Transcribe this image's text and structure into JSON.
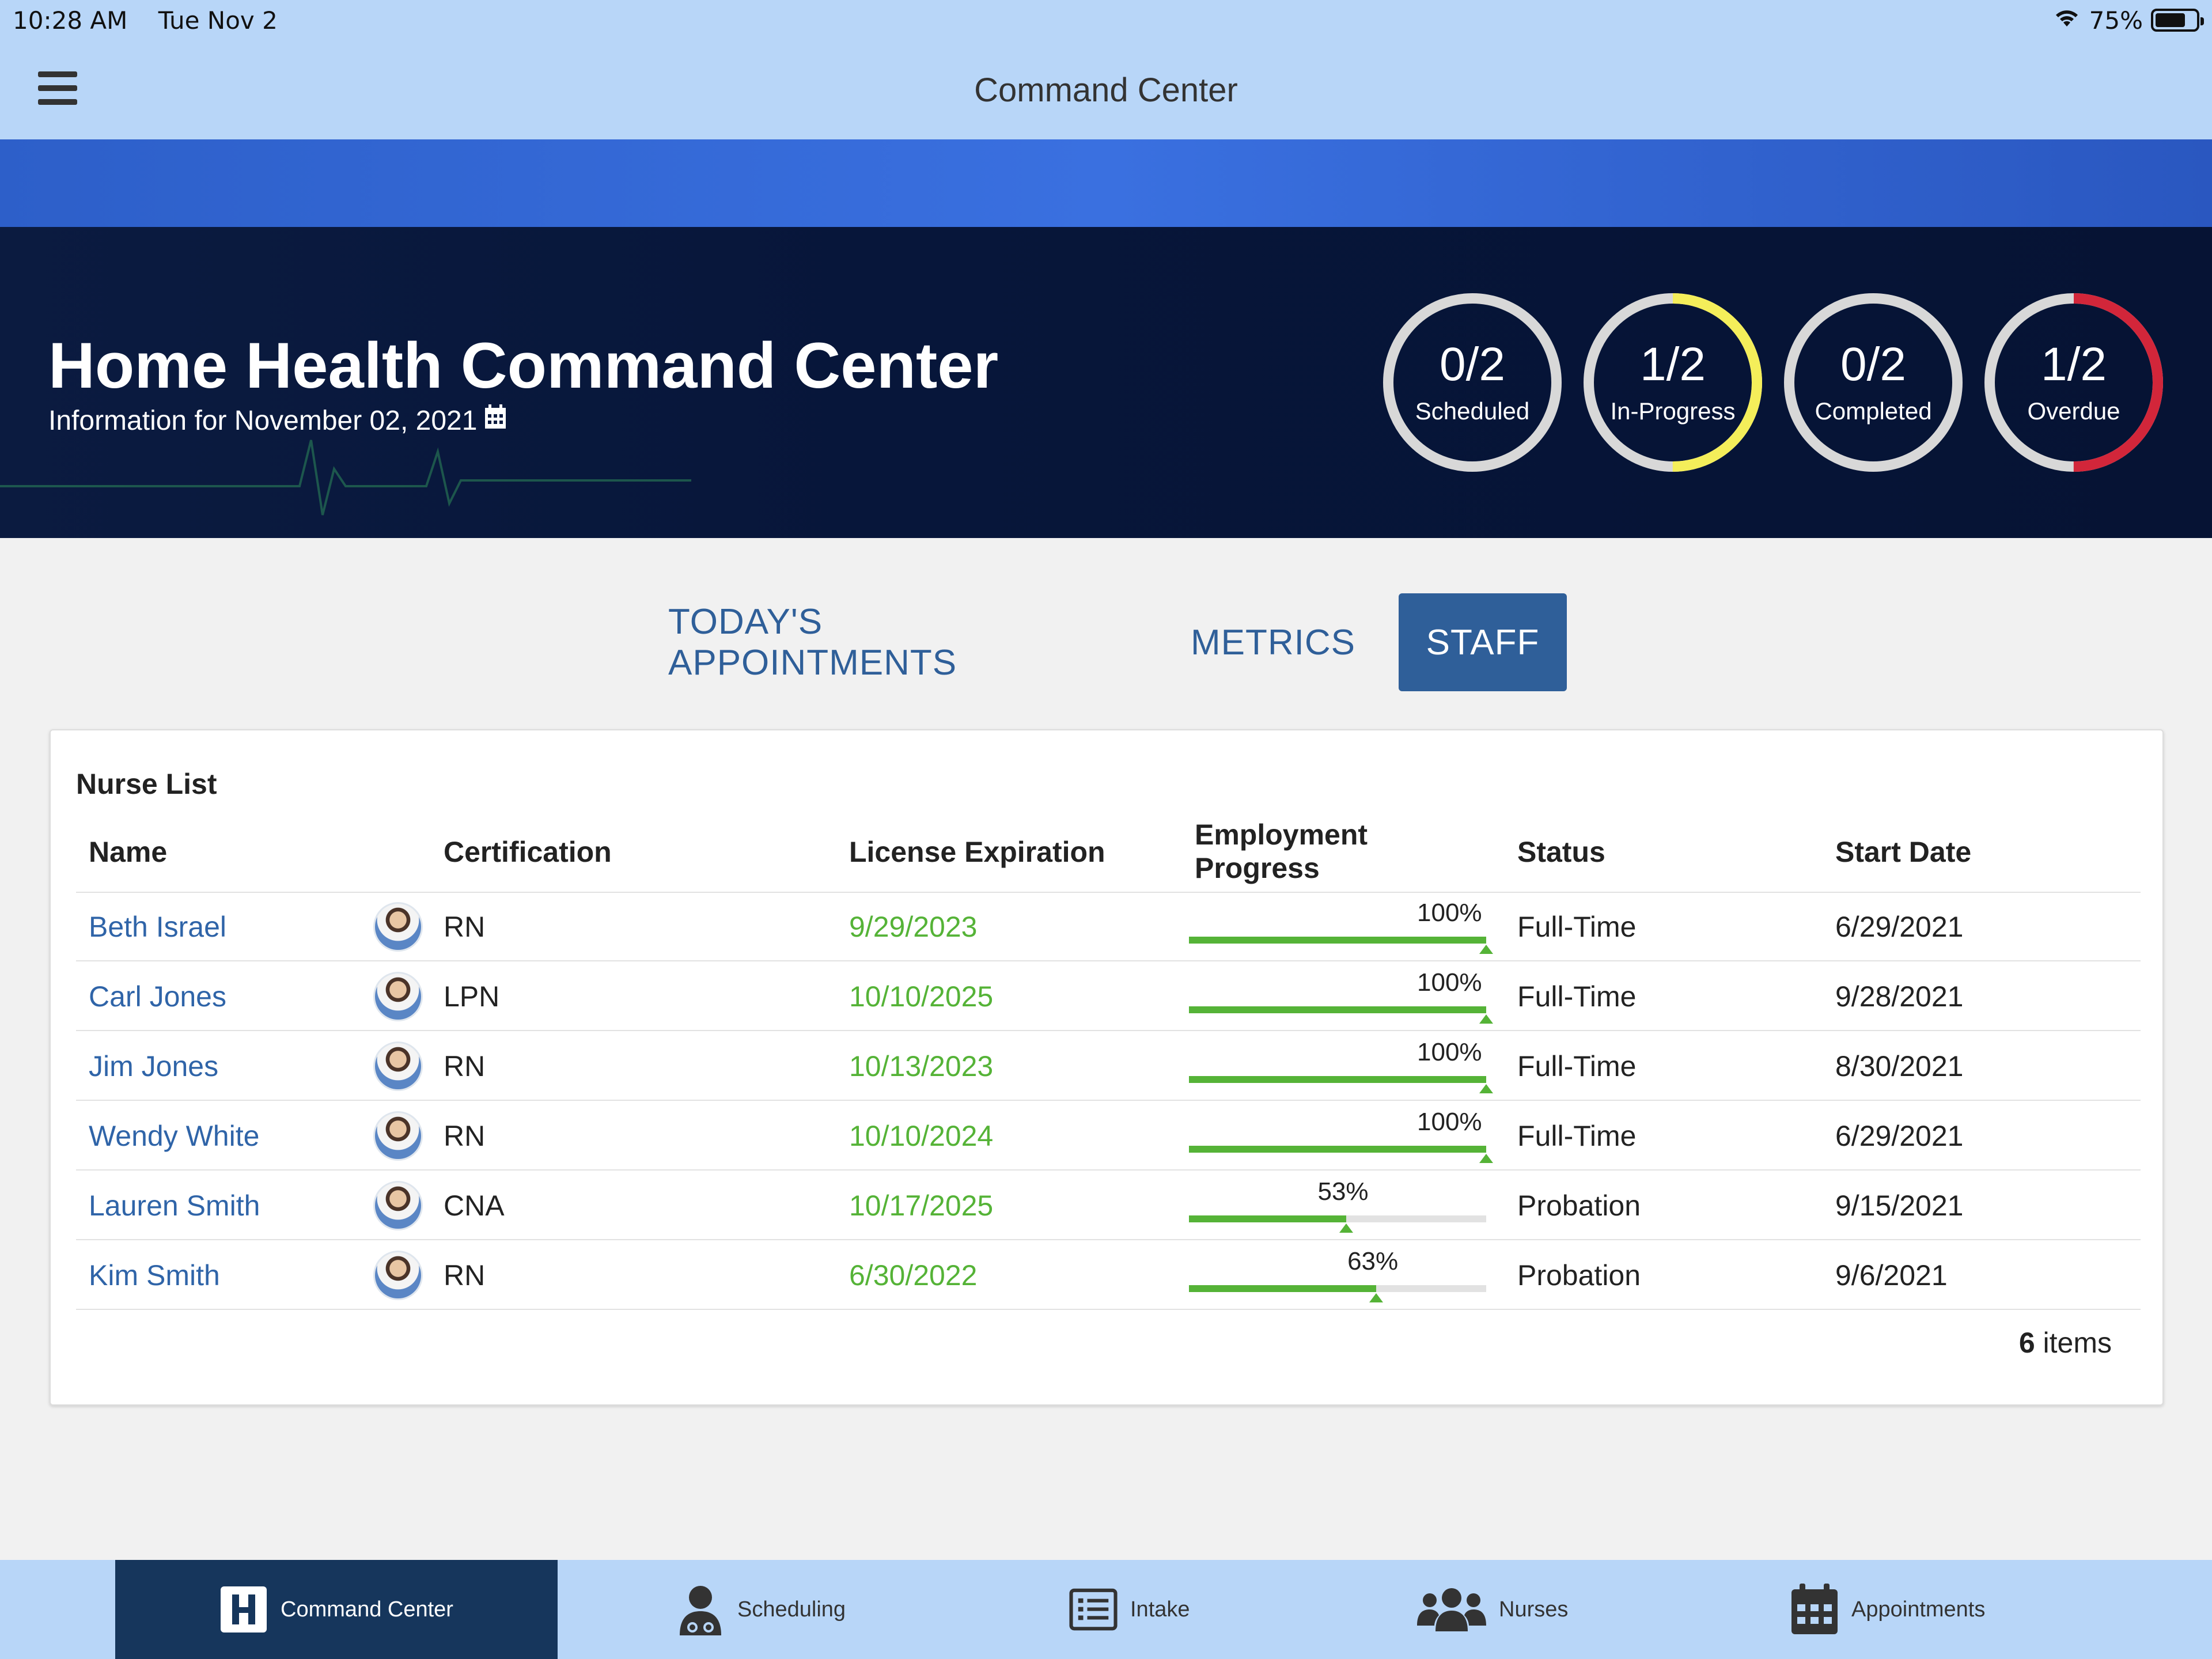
{
  "status_bar": {
    "time": "10:28 AM",
    "date": "Tue Nov 2",
    "battery": "75%",
    "battery_level": 0.75
  },
  "nav": {
    "title": "Command Center"
  },
  "hero": {
    "title": "Home Health Command Center",
    "subtitle": "Information for November 02, 2021",
    "rings": [
      {
        "fraction": "0/2",
        "label": "Scheduled",
        "value": 0,
        "total": 2,
        "color": "#ffffff"
      },
      {
        "fraction": "1/2",
        "label": "In-Progress",
        "value": 1,
        "total": 2,
        "color": "#f4ee5a"
      },
      {
        "fraction": "0/2",
        "label": "Completed",
        "value": 0,
        "total": 2,
        "color": "#ffffff"
      },
      {
        "fraction": "1/2",
        "label": "Overdue",
        "value": 1,
        "total": 2,
        "color": "#d2263a"
      }
    ]
  },
  "tabs": [
    {
      "label": "TODAY'S APPOINTMENTS",
      "active": false
    },
    {
      "label": "METRICS",
      "active": false
    },
    {
      "label": "STAFF",
      "active": true
    }
  ],
  "nurse_list": {
    "title": "Nurse List",
    "columns": {
      "name": "Name",
      "certification": "Certification",
      "license": "License Expiration",
      "progress_line1": "Employment",
      "progress_line2": "Progress",
      "status": "Status",
      "start": "Start Date"
    },
    "rows": [
      {
        "name": "Beth Israel",
        "certification": "RN",
        "license": "9/29/2023",
        "progress": 100,
        "progress_label": "100%",
        "status": "Full-Time",
        "start": "6/29/2021"
      },
      {
        "name": "Carl Jones",
        "certification": "LPN",
        "license": "10/10/2025",
        "progress": 100,
        "progress_label": "100%",
        "status": "Full-Time",
        "start": "9/28/2021"
      },
      {
        "name": "Jim Jones",
        "certification": "RN",
        "license": "10/13/2023",
        "progress": 100,
        "progress_label": "100%",
        "status": "Full-Time",
        "start": "8/30/2021"
      },
      {
        "name": "Wendy White",
        "certification": "RN",
        "license": "10/10/2024",
        "progress": 100,
        "progress_label": "100%",
        "status": "Full-Time",
        "start": "6/29/2021"
      },
      {
        "name": "Lauren Smith",
        "certification": "CNA",
        "license": "10/17/2025",
        "progress": 53,
        "progress_label": "53%",
        "status": "Probation",
        "start": "9/15/2021"
      },
      {
        "name": "Kim Smith",
        "certification": "RN",
        "license": "6/30/2022",
        "progress": 63,
        "progress_label": "63%",
        "status": "Probation",
        "start": "9/6/2021"
      }
    ],
    "items_count": "6",
    "items_label": "items"
  },
  "tabbar": [
    {
      "label": "Command Center",
      "icon": "hospital-h-icon",
      "active": true
    },
    {
      "label": "Scheduling",
      "icon": "doctor-icon",
      "active": false
    },
    {
      "label": "Intake",
      "icon": "list-icon",
      "active": false
    },
    {
      "label": "Nurses",
      "icon": "users-icon",
      "active": false
    },
    {
      "label": "Appointments",
      "icon": "calendar-icon",
      "active": false
    }
  ]
}
